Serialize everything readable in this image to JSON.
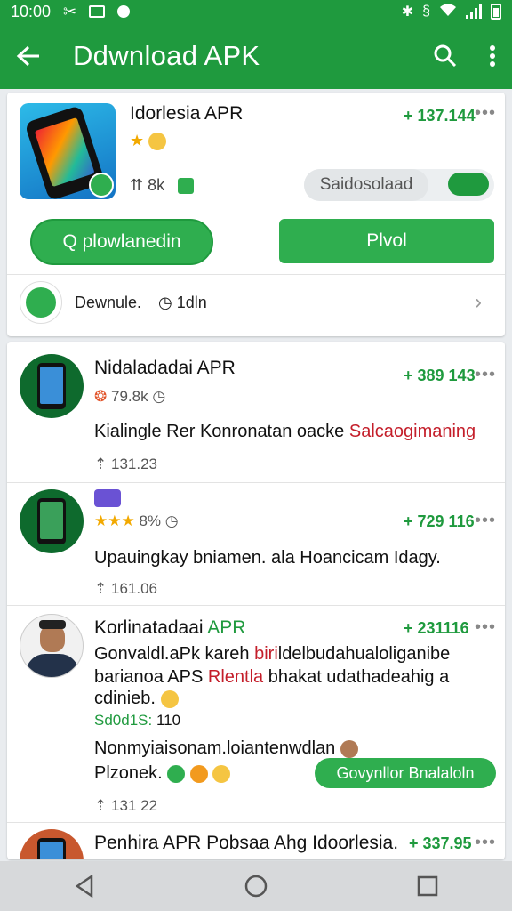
{
  "status_bar": {
    "time": "10:00"
  },
  "app_bar": {
    "title": "Ddwnload APK"
  },
  "featured": {
    "title": "Idorlesia APR",
    "price": "+ 137.144",
    "more": "•••",
    "rating_emoji": "★",
    "meta": "8k",
    "toggle_label": "Saidosolaad",
    "outline_button": "Q plowlanedin",
    "solid_button": "Plvol",
    "download_label": "Dewnule.",
    "time_label": "1dln"
  },
  "list": [
    {
      "title": "Nidaladadai APR",
      "price": "+ 389 143",
      "more": "•••",
      "rating": "79.8k",
      "desc_plain": "Kialingle Rer Konronatan oacke ",
      "desc_red": "Salcaogimaning",
      "meta": "131.23"
    },
    {
      "title": "",
      "price": "+ 729 116",
      "more": "•••",
      "stars": "★★★",
      "rating": "8%",
      "desc": "Upauingkay bniamen.  ala Hoancicam Idagy.",
      "meta": "161.06"
    },
    {
      "title_plain": "Korlinatadaai ",
      "title_green": "APR",
      "price": "+ 231116",
      "more": "•••",
      "line1_plain": "Gonvaldl.aPk kareh ",
      "line1_red": "biri",
      "line1_rest": "ldelbudahualoliganibe",
      "line2_plain": "barianoa APS ",
      "line2_red": "Rlentla",
      "line2_rest": " bhakat udathadeahig a",
      "line3": "cdinieb.",
      "stat_green": "Sd0d1S:",
      "stat_rest": " 110",
      "line4": "Nonmyiaisonam.loiantenwdlan",
      "line5": "Plzonek.",
      "pill_button": "Govynllor Bnalaloln",
      "meta": "131 22"
    },
    {
      "title": "Penhira APR Pobsaa Ahg Idoorlesia.",
      "price": "+ 337.95",
      "more": "•••"
    }
  ]
}
